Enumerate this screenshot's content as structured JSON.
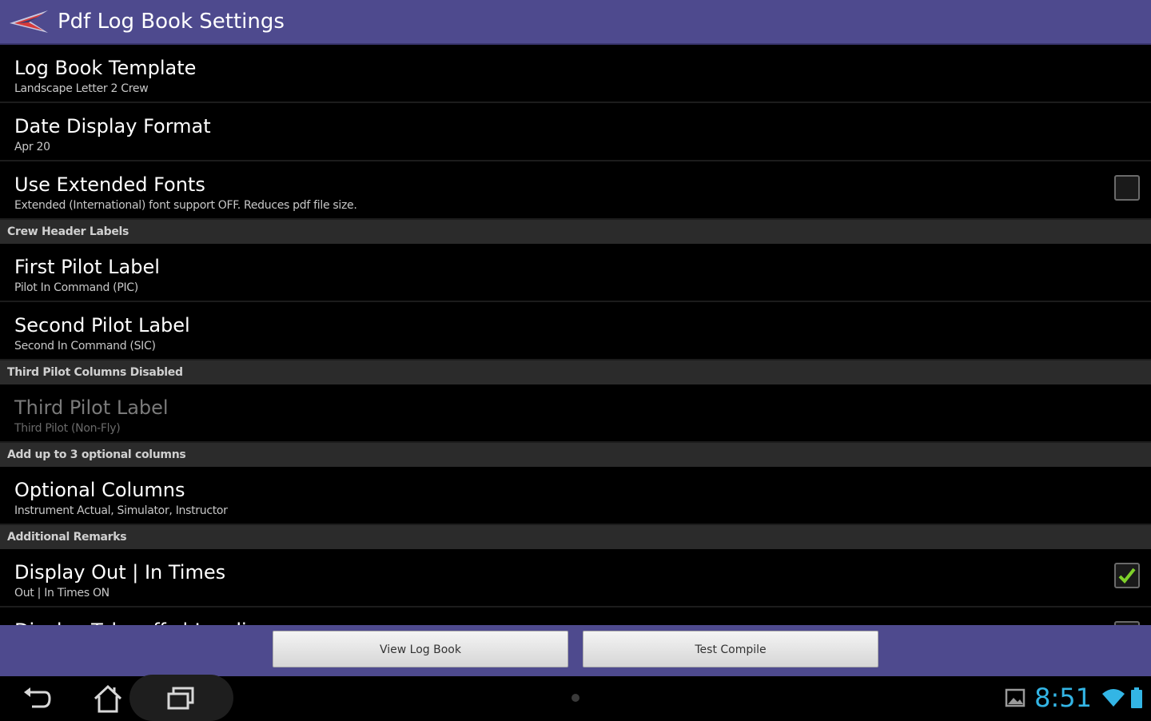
{
  "action_bar": {
    "title": "Pdf Log Book Settings"
  },
  "preferences": [
    {
      "type": "item",
      "title": "Log Book Template",
      "summary": "Landscape Letter 2 Crew"
    },
    {
      "type": "item",
      "title": "Date Display Format",
      "summary": "Apr 20"
    },
    {
      "type": "checkbox",
      "title": "Use Extended Fonts",
      "summary": "Extended (International) font support OFF. Reduces pdf file size.",
      "checked": false
    },
    {
      "type": "category",
      "title": "Crew Header Labels"
    },
    {
      "type": "item",
      "title": "First Pilot Label",
      "summary": "Pilot In Command (PIC)"
    },
    {
      "type": "item",
      "title": "Second Pilot Label",
      "summary": "Second In Command (SIC)"
    },
    {
      "type": "category",
      "title": "Third Pilot Columns Disabled"
    },
    {
      "type": "item",
      "title": "Third Pilot Label",
      "summary": "Third Pilot (Non-Fly)",
      "disabled": true
    },
    {
      "type": "category",
      "title": "Add up to 3 optional columns"
    },
    {
      "type": "item",
      "title": "Optional Columns",
      "summary": "Instrument Actual, Simulator, Instructor"
    },
    {
      "type": "category",
      "title": "Additional Remarks"
    },
    {
      "type": "checkbox",
      "title": "Display Out | In Times",
      "summary": "Out | In Times ON",
      "checked": true
    },
    {
      "type": "checkbox",
      "title": "Display Take-offs | Landings",
      "summary": "",
      "checked": false
    }
  ],
  "buttons": {
    "view_log_book": "View Log Book",
    "test_compile": "Test Compile"
  },
  "status_bar": {
    "time": "8:51"
  },
  "colors": {
    "action_bar": "#4e4a8e",
    "clock": "#33b5e5",
    "check": "#7fd12a"
  },
  "icons": [
    "app-logo-icon",
    "back-icon",
    "home-icon",
    "recent-apps-icon",
    "gallery-icon",
    "wifi-icon",
    "battery-icon"
  ]
}
